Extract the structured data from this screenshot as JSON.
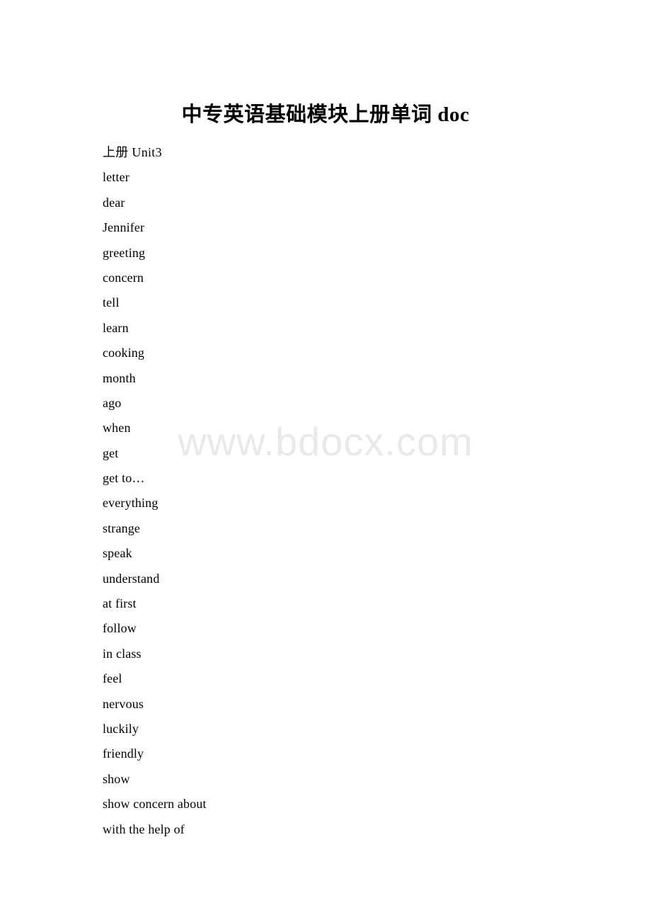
{
  "document": {
    "title": "中专英语基础模块上册单词 doc",
    "watermark": "www.bdocx.com",
    "entries": [
      {
        "text": "上册 Unit3",
        "kind": "section-head"
      },
      {
        "text": "letter",
        "kind": "word"
      },
      {
        "text": "dear",
        "kind": "word"
      },
      {
        "text": "Jennifer",
        "kind": "word"
      },
      {
        "text": "greeting",
        "kind": "word"
      },
      {
        "text": "concern",
        "kind": "word"
      },
      {
        "text": "tell",
        "kind": "word"
      },
      {
        "text": "learn",
        "kind": "word"
      },
      {
        "text": "cooking",
        "kind": "word"
      },
      {
        "text": "month",
        "kind": "word"
      },
      {
        "text": "ago",
        "kind": "word"
      },
      {
        "text": "when",
        "kind": "word"
      },
      {
        "text": "get",
        "kind": "word"
      },
      {
        "text": "get to…",
        "kind": "word"
      },
      {
        "text": "everything",
        "kind": "word"
      },
      {
        "text": "strange",
        "kind": "word"
      },
      {
        "text": "speak",
        "kind": "word"
      },
      {
        "text": "understand",
        "kind": "word"
      },
      {
        "text": "at first",
        "kind": "word"
      },
      {
        "text": "follow",
        "kind": "word"
      },
      {
        "text": "in class",
        "kind": "word"
      },
      {
        "text": "feel",
        "kind": "word"
      },
      {
        "text": "nervous",
        "kind": "word"
      },
      {
        "text": "luckily",
        "kind": "word"
      },
      {
        "text": "friendly",
        "kind": "word"
      },
      {
        "text": "show",
        "kind": "word"
      },
      {
        "text": "show concern about",
        "kind": "word"
      },
      {
        "text": "with the help of",
        "kind": "word"
      }
    ]
  },
  "colors": {
    "page_background": "#ffffff",
    "text": "#000000",
    "watermark": "#e9e9e9"
  }
}
